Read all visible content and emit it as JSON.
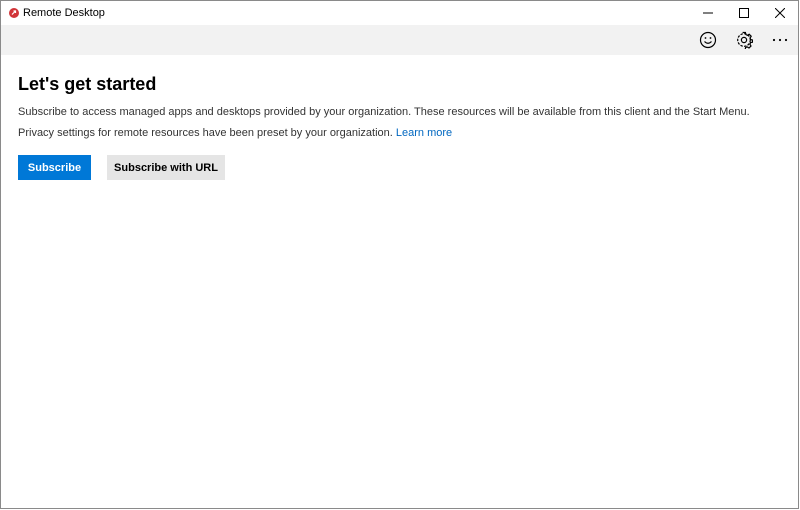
{
  "window": {
    "title": "Remote Desktop",
    "accent": "#0078d7",
    "icon": "remote-desktop-app-icon"
  },
  "toolbar": {
    "icons": [
      "smiley-feedback-icon",
      "gear-icon",
      "more-options-icon"
    ]
  },
  "main": {
    "heading": "Let's get started",
    "description": "Subscribe to access managed apps and desktops provided by your organization. These resources will be available from this client and the Start Menu.",
    "privacy_text": "Privacy settings for remote resources have been preset by your organization.",
    "learn_more": "Learn more",
    "subscribe_label": "Subscribe",
    "subscribe_url_label": "Subscribe with URL"
  }
}
